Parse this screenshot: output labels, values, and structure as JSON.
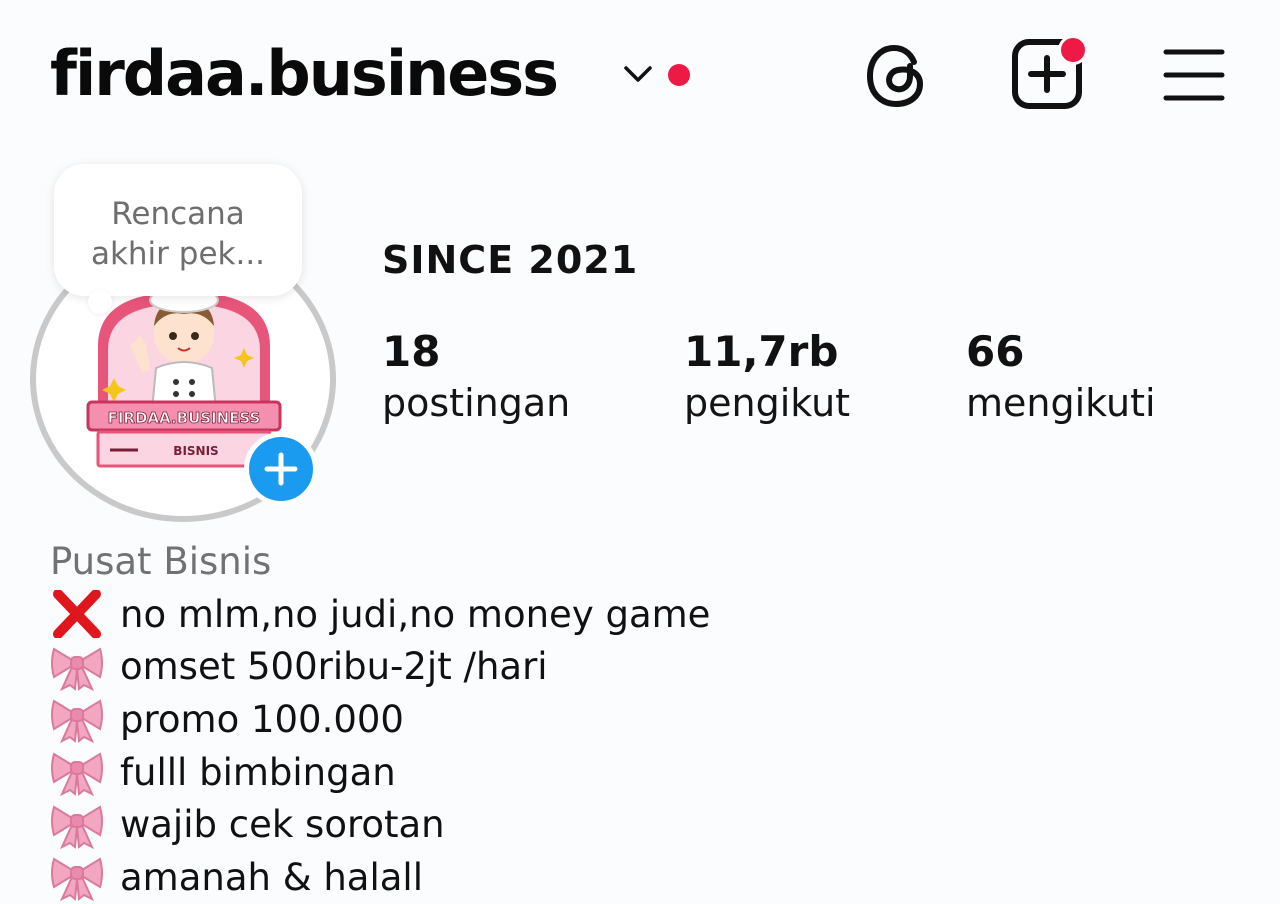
{
  "header": {
    "username": "firdaa.business",
    "icons": [
      "chevron-down-icon",
      "notification-dot",
      "threads-icon",
      "create-post-icon",
      "menu-icon"
    ]
  },
  "note": {
    "text": "Rencana\nakhir pek..."
  },
  "profile": {
    "tagline": "SINCE 2021",
    "avatar_logo_text": "FIRDAA.BUSINESS BISNIS",
    "stats": [
      {
        "value": "18",
        "label": "postingan"
      },
      {
        "value": "11,7rb",
        "label": "pengikut"
      },
      {
        "value": "66",
        "label": "mengikuti"
      }
    ]
  },
  "bio": {
    "category": "Pusat Bisnis",
    "lines": [
      {
        "icon": "red-cross-icon",
        "text": "no mlm,no judi,no money game"
      },
      {
        "icon": "pink-ribbon-icon",
        "text": "omset 500ribu-2jt /hari"
      },
      {
        "icon": "pink-ribbon-icon",
        "text": "promo 100.000"
      },
      {
        "icon": "pink-ribbon-icon",
        "text": "fulll bimbingan"
      },
      {
        "icon": "pink-ribbon-icon",
        "text": "wajib cek sorotan"
      },
      {
        "icon": "pink-ribbon-icon",
        "text": "amanah & halall"
      }
    ]
  },
  "colors": {
    "accent_red": "#ee1a45",
    "add_story_blue": "#1a9bf0",
    "ribbon_pink": "#f3a6c0",
    "muted_text": "#727272"
  }
}
